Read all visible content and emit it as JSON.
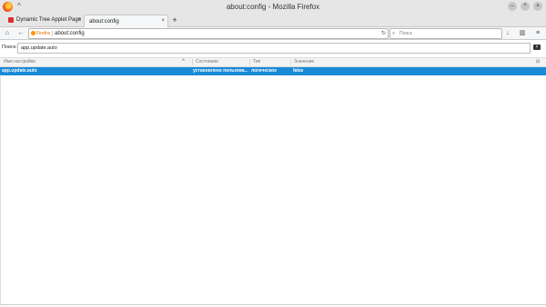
{
  "window": {
    "title": "about:config - Mozilla Firefox",
    "minimize_glyph": "–",
    "maximize_glyph": "^",
    "close_glyph": "×"
  },
  "tabs": [
    {
      "label": "Dynamic Tree Applet Page",
      "close": "×"
    },
    {
      "label": "about:config",
      "close": "×"
    }
  ],
  "new_tab": "+",
  "nav": {
    "home_glyph": "⌂",
    "back_glyph": "←",
    "identity_label": "Firefox",
    "url": "about:config",
    "reload_glyph": "↻",
    "search_placeholder": "Поиск",
    "download_glyph": "↓",
    "sidebar_glyph": "▥",
    "menu_glyph": "≡"
  },
  "config_search": {
    "label": "Поиск:",
    "value": "app.update.auto",
    "clear_glyph": "×"
  },
  "table": {
    "columns": [
      "Имя настройки",
      "Состояние",
      "Тип",
      "Значение"
    ],
    "sort_indicator": "^",
    "column_picker_glyph": "⊟",
    "rows": [
      {
        "name": "app.update.auto",
        "state": "установлено пользова...",
        "type": "логическое",
        "value": "false"
      }
    ]
  },
  "colors": {
    "selected_row": "#1a8ad7",
    "chrome": "#e6e6e6"
  }
}
